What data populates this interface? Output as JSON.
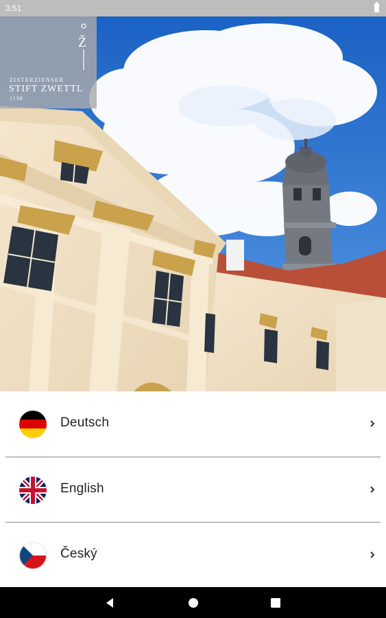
{
  "status": {
    "time": "3:51"
  },
  "logo": {
    "mark": "Ž",
    "subtitle": "ZISTERZIENSER",
    "name": "STIFT ZWETTL",
    "year": "1138"
  },
  "languages": [
    {
      "label": "Deutsch",
      "flag": "flag-germany"
    },
    {
      "label": "English",
      "flag": "flag-united-kingdom"
    },
    {
      "label": "Český",
      "flag": "flag-czech-republic"
    }
  ],
  "navigation": {
    "back": "back-icon",
    "home": "home-icon",
    "recents": "recents-icon"
  }
}
